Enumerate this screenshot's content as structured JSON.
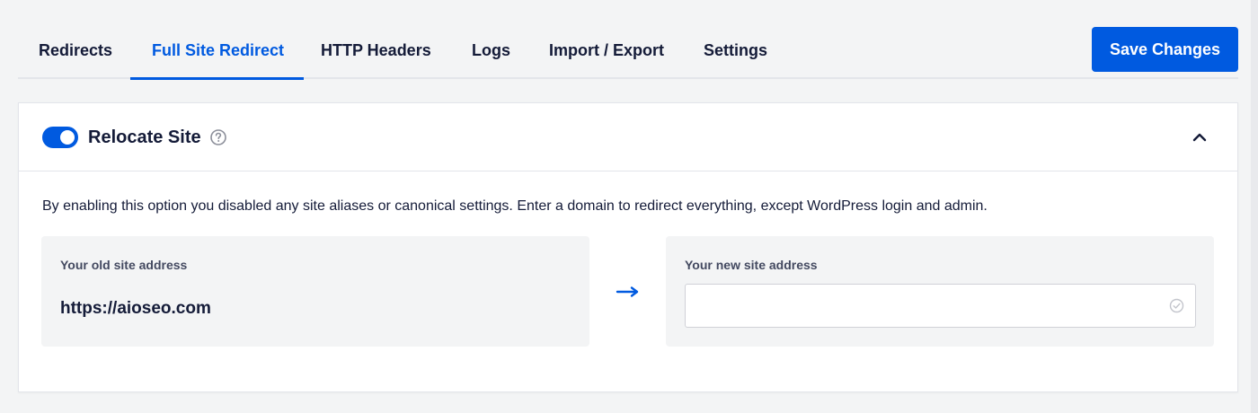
{
  "tabs": [
    {
      "label": "Redirects",
      "active": false
    },
    {
      "label": "Full Site Redirect",
      "active": true
    },
    {
      "label": "HTTP Headers",
      "active": false
    },
    {
      "label": "Logs",
      "active": false
    },
    {
      "label": "Import / Export",
      "active": false
    },
    {
      "label": "Settings",
      "active": false
    }
  ],
  "toolbar": {
    "save_label": "Save Changes"
  },
  "relocate": {
    "title": "Relocate Site",
    "enabled": true,
    "description": "By enabling this option you disabled any site aliases or canonical settings. Enter a domain to redirect everything, except WordPress login and admin.",
    "old_address": {
      "label": "Your old site address",
      "value": "https://aioseo.com"
    },
    "new_address": {
      "label": "Your new site address",
      "value": "",
      "placeholder": ""
    }
  },
  "icons": {
    "help": "question-circle-icon",
    "collapse": "chevron-up-icon",
    "arrow": "arrow-right-icon",
    "check": "check-circle-icon"
  },
  "colors": {
    "accent": "#005ae0",
    "text": "#141b38",
    "muted": "#434960",
    "background": "#f3f4f5",
    "border": "#e3e5ea"
  }
}
